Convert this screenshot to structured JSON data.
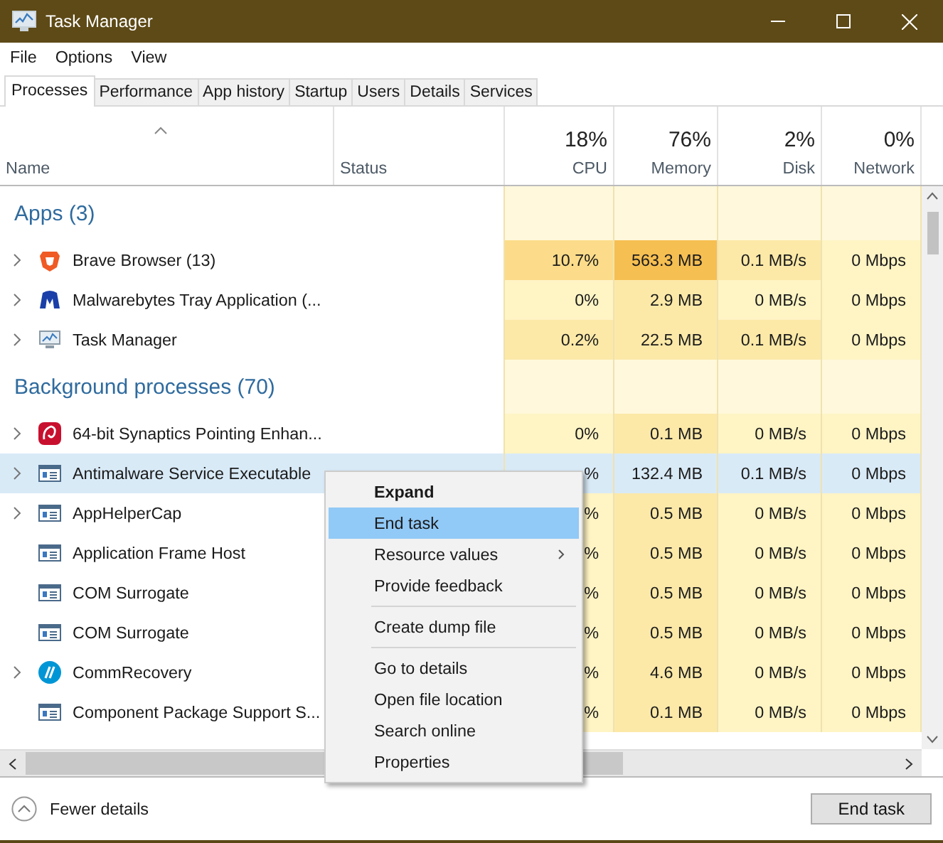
{
  "window": {
    "title": "Task Manager"
  },
  "menu": [
    "File",
    "Options",
    "View"
  ],
  "tabs": [
    {
      "label": "Processes",
      "selected": true
    },
    {
      "label": "Performance",
      "selected": false
    },
    {
      "label": "App history",
      "selected": false
    },
    {
      "label": "Startup",
      "selected": false
    },
    {
      "label": "Users",
      "selected": false
    },
    {
      "label": "Details",
      "selected": false
    },
    {
      "label": "Services",
      "selected": false
    }
  ],
  "columns": [
    {
      "label": "Name",
      "sorted": true
    },
    {
      "label": "Status",
      "sorted": false
    },
    {
      "label": "CPU",
      "total": "18%",
      "sorted": false
    },
    {
      "label": "Memory",
      "total": "76%",
      "sorted": false
    },
    {
      "label": "Disk",
      "total": "2%",
      "sorted": false
    },
    {
      "label": "Network",
      "total": "0%",
      "sorted": false
    }
  ],
  "groups": [
    {
      "title": "Apps (3)",
      "processes": [
        {
          "name": "Brave Browser (13)",
          "expandable": true,
          "selected": false,
          "cells": [
            {
              "text": "10.7%",
              "color": "#fcdc8a"
            },
            {
              "text": "563.3 MB",
              "color": "#f6bf52"
            },
            {
              "text": "0.1 MB/s",
              "color": "#fce9a8"
            },
            {
              "text": "0 Mbps",
              "color": "#fff4c4"
            }
          ]
        },
        {
          "name": "Malwarebytes Tray Application (...",
          "expandable": true,
          "selected": false,
          "cells": [
            {
              "text": "0%",
              "color": "#fff4c4"
            },
            {
              "text": "2.9 MB",
              "color": "#fce9a8"
            },
            {
              "text": "0 MB/s",
              "color": "#fff4c4"
            },
            {
              "text": "0 Mbps",
              "color": "#fff4c4"
            }
          ]
        },
        {
          "name": "Task Manager",
          "expandable": true,
          "selected": false,
          "cells": [
            {
              "text": "0.2%",
              "color": "#fce9a8"
            },
            {
              "text": "22.5 MB",
              "color": "#fce9a8"
            },
            {
              "text": "0.1 MB/s",
              "color": "#fce9a8"
            },
            {
              "text": "0 Mbps",
              "color": "#fff4c4"
            }
          ]
        }
      ]
    },
    {
      "title": "Background processes (70)",
      "processes": [
        {
          "name": "64-bit Synaptics Pointing Enhan...",
          "expandable": true,
          "selected": false,
          "cells": [
            {
              "text": "0%",
              "color": "#fff4c4"
            },
            {
              "text": "0.1 MB",
              "color": "#fce9a8"
            },
            {
              "text": "0 MB/s",
              "color": "#fff4c4"
            },
            {
              "text": "0 Mbps",
              "color": "#fff4c4"
            }
          ]
        },
        {
          "name": "Antimalware Service Executable",
          "expandable": true,
          "selected": true,
          "cells": [
            {
              "text": "%"
            },
            {
              "text": "132.4 MB"
            },
            {
              "text": "0.1 MB/s"
            },
            {
              "text": "0 Mbps"
            }
          ]
        },
        {
          "name": "AppHelperCap",
          "expandable": true,
          "selected": false,
          "cells": [
            {
              "text": "%",
              "color": "#fff4c4"
            },
            {
              "text": "0.5 MB",
              "color": "#fce9a8"
            },
            {
              "text": "0 MB/s",
              "color": "#fff4c4"
            },
            {
              "text": "0 Mbps",
              "color": "#fff4c4"
            }
          ]
        },
        {
          "name": "Application Frame Host",
          "expandable": false,
          "selected": false,
          "cells": [
            {
              "text": "%",
              "color": "#fff4c4"
            },
            {
              "text": "0.5 MB",
              "color": "#fce9a8"
            },
            {
              "text": "0 MB/s",
              "color": "#fff4c4"
            },
            {
              "text": "0 Mbps",
              "color": "#fff4c4"
            }
          ]
        },
        {
          "name": "COM Surrogate",
          "expandable": false,
          "selected": false,
          "cells": [
            {
              "text": "%",
              "color": "#fff4c4"
            },
            {
              "text": "0.5 MB",
              "color": "#fce9a8"
            },
            {
              "text": "0 MB/s",
              "color": "#fff4c4"
            },
            {
              "text": "0 Mbps",
              "color": "#fff4c4"
            }
          ]
        },
        {
          "name": "COM Surrogate",
          "expandable": false,
          "selected": false,
          "cells": [
            {
              "text": "%",
              "color": "#fff4c4"
            },
            {
              "text": "0.5 MB",
              "color": "#fce9a8"
            },
            {
              "text": "0 MB/s",
              "color": "#fff4c4"
            },
            {
              "text": "0 Mbps",
              "color": "#fff4c4"
            }
          ]
        },
        {
          "name": "CommRecovery",
          "expandable": true,
          "selected": false,
          "cells": [
            {
              "text": "%",
              "color": "#fff4c4"
            },
            {
              "text": "4.6 MB",
              "color": "#fce9a8"
            },
            {
              "text": "0 MB/s",
              "color": "#fff4c4"
            },
            {
              "text": "0 Mbps",
              "color": "#fff4c4"
            }
          ]
        },
        {
          "name": "Component Package Support S...",
          "expandable": false,
          "selected": false,
          "cells": [
            {
              "text": "%",
              "color": "#fff4c4"
            },
            {
              "text": "0.1 MB",
              "color": "#fce9a8"
            },
            {
              "text": "0 MB/s",
              "color": "#fff4c4"
            },
            {
              "text": "0 Mbps",
              "color": "#fff4c4"
            }
          ]
        }
      ]
    }
  ],
  "context_menu": [
    {
      "kind": "item",
      "label": "Expand",
      "default": true,
      "selected": false,
      "submenu": false
    },
    {
      "kind": "item",
      "label": "End task",
      "default": false,
      "selected": true,
      "submenu": false
    },
    {
      "kind": "item",
      "label": "Resource values",
      "default": false,
      "selected": false,
      "submenu": true
    },
    {
      "kind": "item",
      "label": "Provide feedback",
      "default": false,
      "selected": false,
      "submenu": false
    },
    {
      "kind": "separator"
    },
    {
      "kind": "item",
      "label": "Create dump file",
      "default": false,
      "selected": false,
      "submenu": false
    },
    {
      "kind": "separator"
    },
    {
      "kind": "item",
      "label": "Go to details",
      "default": false,
      "selected": false,
      "submenu": false
    },
    {
      "kind": "item",
      "label": "Open file location",
      "default": false,
      "selected": false,
      "submenu": false
    },
    {
      "kind": "item",
      "label": "Search online",
      "default": false,
      "selected": false,
      "submenu": false
    },
    {
      "kind": "item",
      "label": "Properties",
      "default": false,
      "selected": false,
      "submenu": false
    }
  ],
  "footer": {
    "toggle": "Fewer details",
    "button": "End task"
  }
}
